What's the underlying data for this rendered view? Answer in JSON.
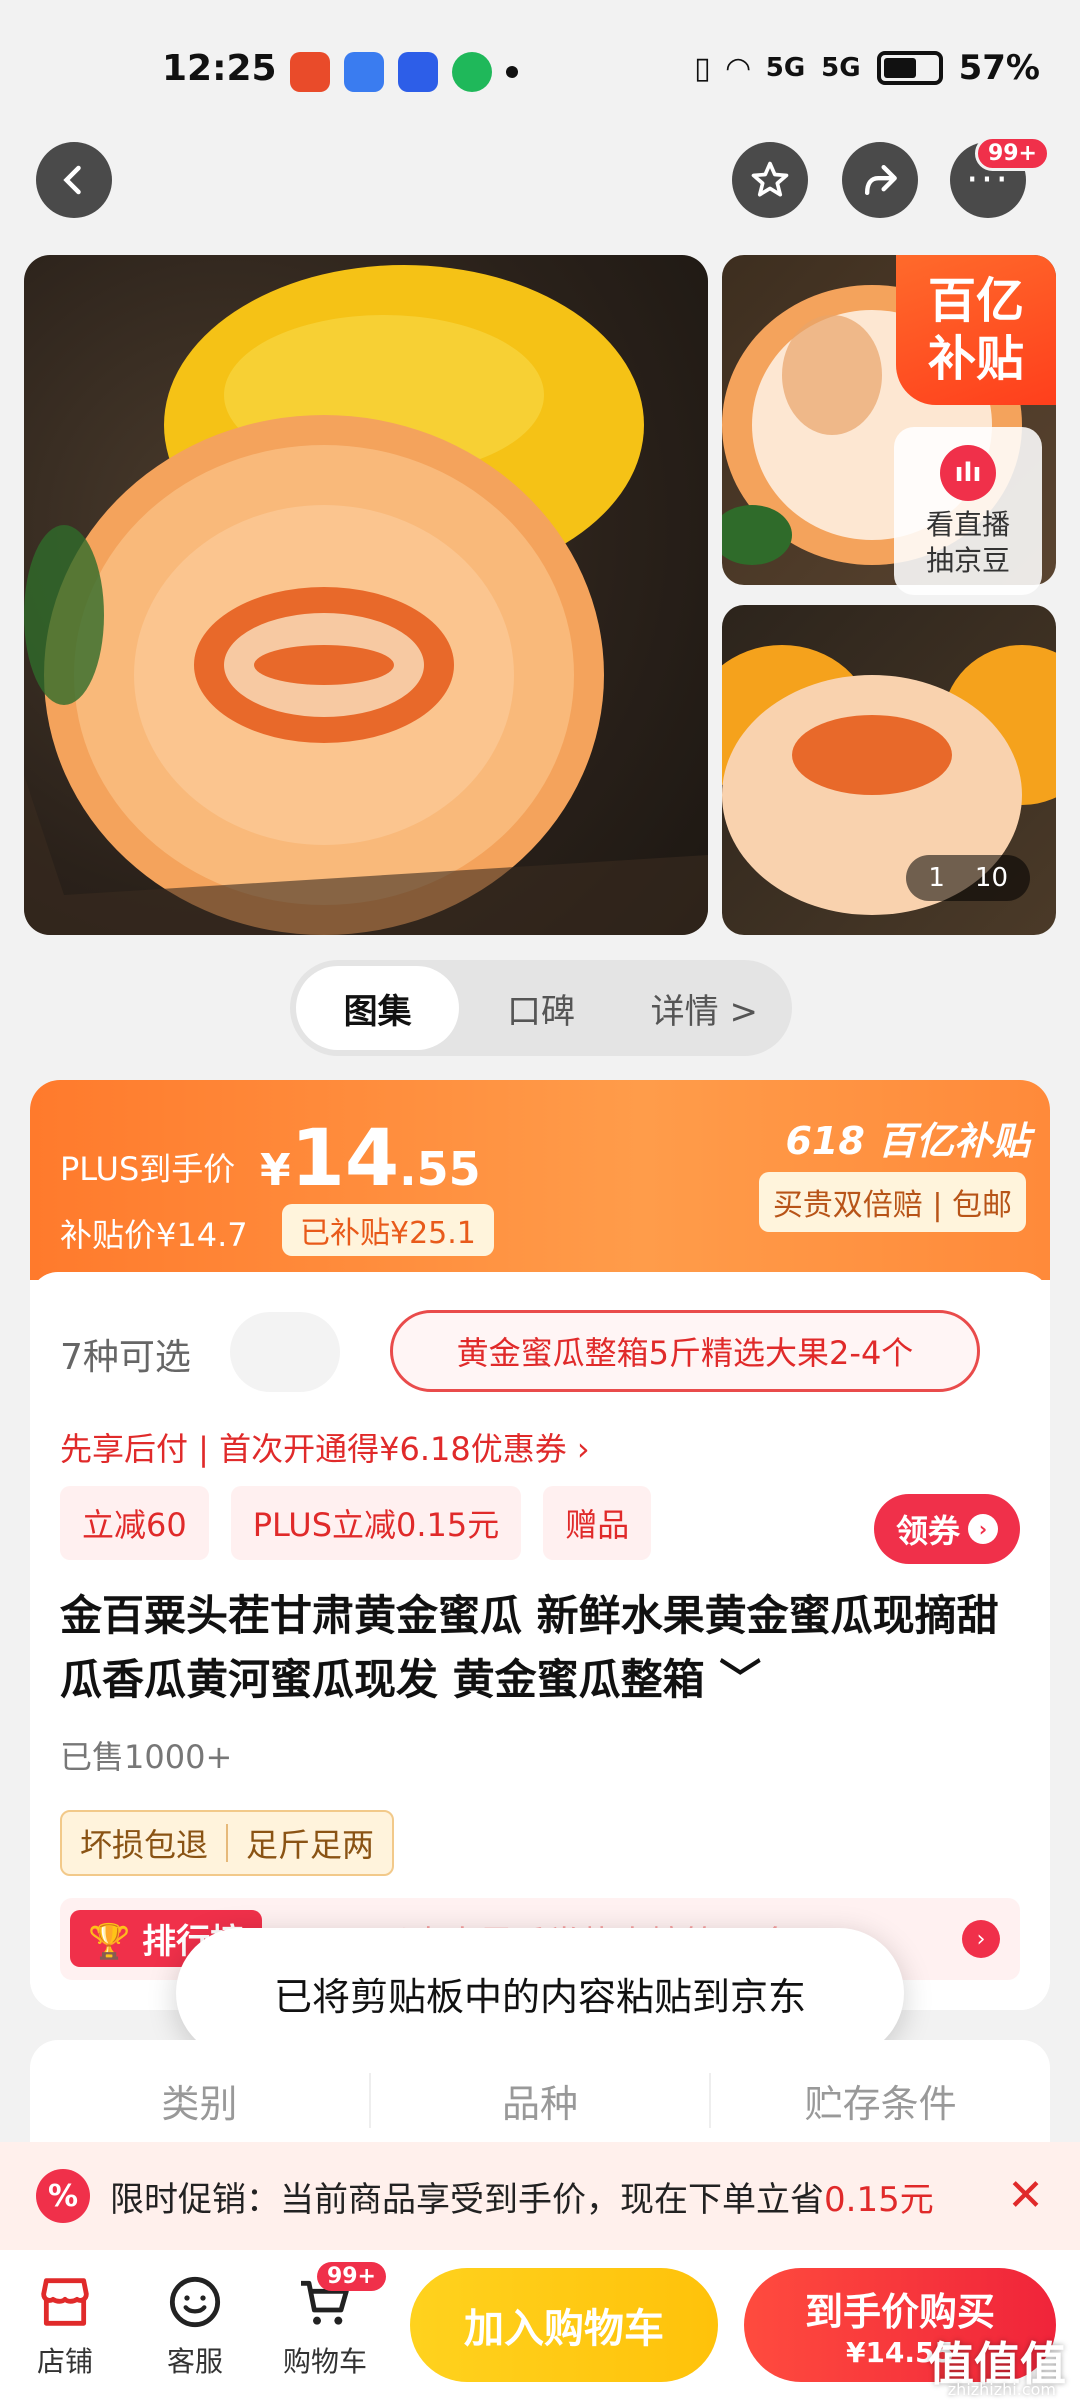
{
  "status_bar": {
    "time": "12:25",
    "signal1": "5G",
    "signal2": "5G",
    "battery": "57%"
  },
  "nav": {
    "more_badge": "99+"
  },
  "gallery": {
    "subsidy_line1": "百亿",
    "subsidy_line2": "补贴",
    "live_line1": "看直播",
    "live_line2": "抽京豆",
    "page_current": "1",
    "page_total": "10"
  },
  "tabs": [
    "图集",
    "口碑",
    "详情 >"
  ],
  "price": {
    "plus_label": "PLUS到手价",
    "yen": "¥",
    "int": "14",
    "dec": ".55",
    "sub_price": "补贴价¥14.7",
    "sub_tag": "已补贴¥25.1",
    "right_title": "618 百亿补贴",
    "right_badge": "买贵双倍赔 | 包邮"
  },
  "options": {
    "count": "7种可选",
    "selected": "黄金蜜瓜整箱5斤精选大果2-4个"
  },
  "pay_later": "先享后付 | 首次开通得¥6.18优惠券 ›",
  "chips": [
    "立减60",
    "PLUS立减0.15元",
    "赠品"
  ],
  "coupon": "领券",
  "title": "金百粟头茬甘肃黄金蜜瓜 新鲜水果黄金蜜瓜现摘甜瓜香瓜黄河蜜瓜现发 黄金蜜瓜整箱 ﹀",
  "sold": "已售1000+",
  "guarantee": [
    "坏损包退",
    "足斤足两"
  ],
  "rank": {
    "label": "排行榜",
    "text": "50元以内水果瓜类热卖榜第27名"
  },
  "toast": "已将剪贴板中的内容粘贴到京东",
  "specs": [
    "类别",
    "品种",
    "贮存条件"
  ],
  "promo": {
    "icon": "%",
    "text": "限时促销：当前商品享受到手价，现在下单立省",
    "amount": "0.15元",
    "close": "✕"
  },
  "bottom": {
    "store": "店铺",
    "service": "客服",
    "cart": "购物车",
    "cart_badge": "99+",
    "add_cart": "加入购物车",
    "buy_l1": "到手价购买",
    "buy_l2": "¥14.55"
  },
  "watermark": {
    "main": "值值值",
    "sub": "zhizhizhi.com"
  },
  "colors": {
    "accent_red": "#f0304a",
    "accent_orange": "#ff7a2c",
    "cart_yellow": "#ffc20a"
  }
}
